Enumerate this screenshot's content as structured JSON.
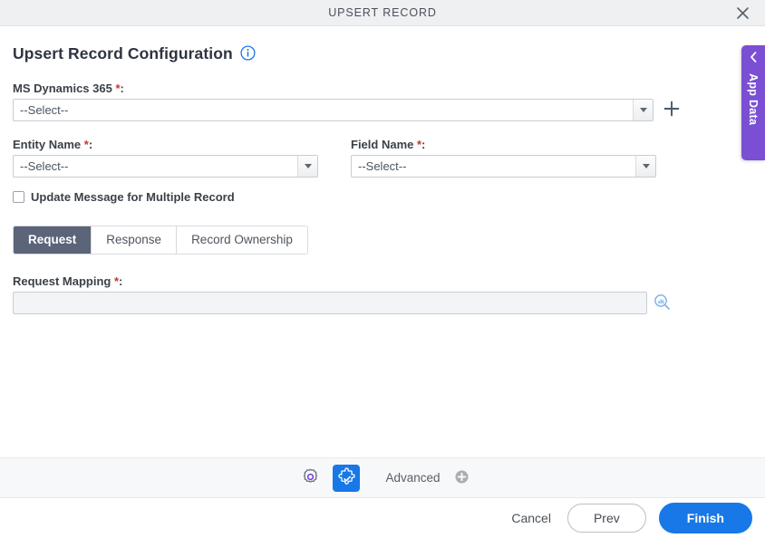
{
  "window": {
    "title": "UPSERT RECORD",
    "close_label": "close-icon"
  },
  "page": {
    "heading": "Upsert Record Configuration",
    "info_tooltip": "info-icon"
  },
  "form": {
    "connection": {
      "label": "MS Dynamics 365",
      "required_marker": "*",
      "colon": ":",
      "value": "--Select--",
      "add_label": "+"
    },
    "entity_name": {
      "label": "Entity Name",
      "required_marker": "*",
      "colon": ":",
      "value": "--Select--"
    },
    "field_name": {
      "label": "Field Name",
      "required_marker": "*",
      "colon": ":",
      "value": "--Select--"
    },
    "update_multiple": {
      "label": "Update Message for Multiple Record",
      "checked": false
    },
    "request_mapping": {
      "label": "Request Mapping",
      "required_marker": "*",
      "colon": ":",
      "value": "",
      "placeholder": ""
    }
  },
  "tabs": [
    {
      "label": "Request",
      "active": true
    },
    {
      "label": "Response",
      "active": false
    },
    {
      "label": "Record Ownership",
      "active": false
    }
  ],
  "side_panel": {
    "label": "App Data",
    "collapse_icon": "chevron-left-icon"
  },
  "toolbar": {
    "settings_icon": "gear-icon",
    "plugin_icon": "puzzle-check-icon",
    "advanced_label": "Advanced",
    "advanced_add_icon": "circle-plus-icon"
  },
  "footer": {
    "cancel_label": "Cancel",
    "prev_label": "Prev",
    "finish_label": "Finish"
  },
  "colors": {
    "accent_blue": "#1878e8",
    "tab_active": "#5b6478",
    "app_data_purple": "#7b4fd4",
    "required_red": "#c0392b",
    "titlebar_bg": "#eff0f2"
  }
}
